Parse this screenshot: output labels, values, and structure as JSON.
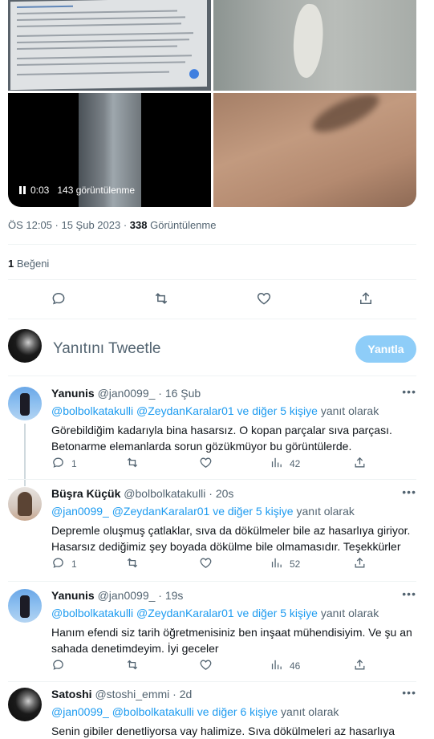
{
  "media": {
    "video_time": "0:03",
    "video_views": "143 görüntülenme"
  },
  "tweet_meta": {
    "time": "ÖS 12:05 · 15 Şub 2023 · ",
    "views_count": "338",
    "views_label": " Görüntülenme"
  },
  "likes": {
    "count": "1",
    "label": " Beğeni"
  },
  "compose": {
    "placeholder": "Yanıtını Tweetle",
    "button": "Yanıtla"
  },
  "replies": [
    {
      "name": "Yanunis",
      "handle": "@jan0099_ · 16 Şub",
      "replying_mentions": "@bolbolkatakulli @ZeydanKaralar01  ve diğer 5 kişiye",
      "replying_suffix": " yanıt olarak",
      "text": "Görebildiğim kadarıyla bina hasarsız. O kopan parçalar sıva parçası. Betonarme elemanlarda sorun gözükmüyor bu görüntülerde.",
      "reply_count": "1",
      "retweet_count": "",
      "like_count": "",
      "views": "42"
    },
    {
      "name": "Büşra Küçük",
      "handle": "@bolbolkatakulli · 20s",
      "replying_mentions": "@jan0099_ @ZeydanKaralar01  ve diğer 5 kişiye",
      "replying_suffix": " yanıt olarak",
      "text": "Depremle oluşmuş çatlaklar, sıva da dökülmeler bile az hasarlıya giriyor. Hasarsız dediğimiz şey boyada dökülme bile olmamasıdır. Teşekkürler",
      "reply_count": "1",
      "retweet_count": "",
      "like_count": "",
      "views": "52"
    },
    {
      "name": "Yanunis",
      "handle": "@jan0099_ · 19s",
      "replying_mentions": "@bolbolkatakulli @ZeydanKaralar01  ve diğer 5 kişiye",
      "replying_suffix": " yanıt olarak",
      "text": "Hanım efendi siz tarih öğretmenisiniz ben inşaat mühendisiyim. Ve şu an sahada denetimdeyim. İyi geceler",
      "reply_count": "",
      "retweet_count": "",
      "like_count": "",
      "views": "46"
    },
    {
      "name": "Satoshi",
      "handle": "@stoshi_emmi · 2d",
      "replying_mentions": "@jan0099_ @bolbolkatakulli  ve diğer 6 kişiye",
      "replying_suffix": " yanıt olarak",
      "text": "Senin gibiler denetliyorsa vay halimize. Sıva dökülmeleri az hasarlıya girer."
    }
  ],
  "icons": {
    "reply": "speech-bubble",
    "retweet": "retweet-arrows",
    "like": "heart",
    "share": "share-up-arrow",
    "views": "bar-chart",
    "more": "three-dots"
  },
  "colors": {
    "accent": "#1d9bf0",
    "reply_button_disabled": "#8ecdf8"
  }
}
